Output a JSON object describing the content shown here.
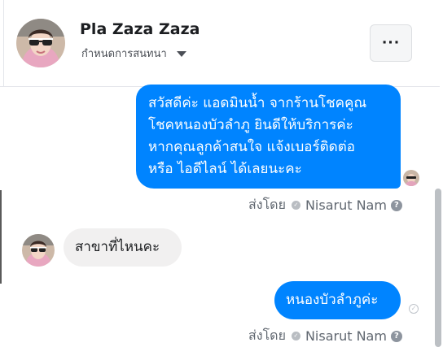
{
  "header": {
    "name": "Pla Zaza Zaza",
    "subtitle": "กำหนดการสนทนา",
    "more_label": "···"
  },
  "messages": [
    {
      "direction": "outgoing",
      "lines": [
        "สวัสดีค่ะ แอดมินน้ำ จากร้านโชคคูณ",
        "โชคหนองบัวลำภู ยินดีให้บริการค่ะ",
        "หากคุณลูกค้าสนใจ แจ้งเบอร์ติดต่อ",
        "หรือ ไอดีไลน์ ได้เลยนะคะ"
      ],
      "sent_by_label": "ส่งโดย",
      "sender": "Nisarut Nam"
    },
    {
      "direction": "incoming",
      "text": "สาขาที่ไหนคะ"
    },
    {
      "direction": "outgoing",
      "text": "หนองบัวลำภูค่ะ",
      "sent_by_label": "ส่งโดย",
      "sender": "Nisarut Nam"
    }
  ],
  "colors": {
    "outgoing_bubble": "#0084ff",
    "incoming_bubble": "#f1f0f0",
    "meta_text": "#606770"
  },
  "icons": {
    "help": "?",
    "check": "✓"
  }
}
